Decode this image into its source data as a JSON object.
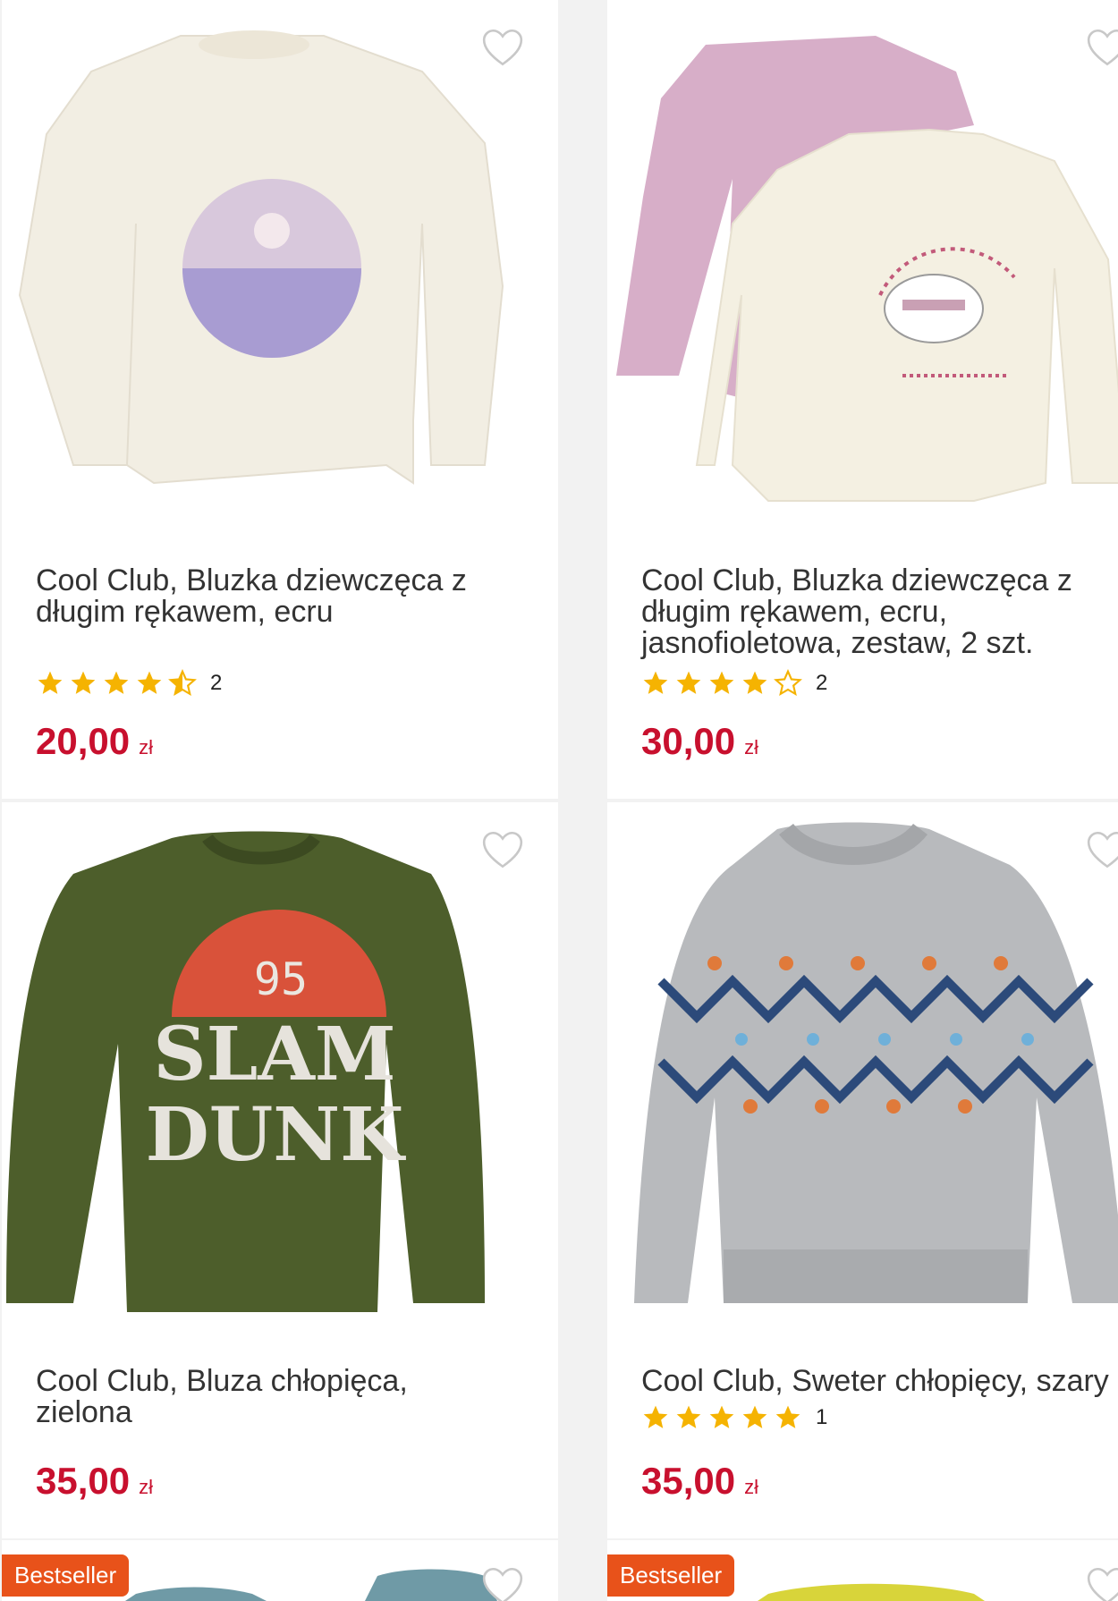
{
  "products": [
    {
      "title": "Cool Club, Bluzka dziewczęca z długim rękawem, ecru",
      "rating_count": "2",
      "rating": 4.5,
      "price": "20,00",
      "currency": "zł"
    },
    {
      "title": "Cool Club, Bluzka dziewczęca z długim rękawem, ecru, jasnofioletowa, zestaw, 2 szt.",
      "rating_count": "2",
      "rating": 4,
      "price": "30,00",
      "currency": "zł"
    },
    {
      "title": "Cool Club, Bluza chłopięca, zielona",
      "price": "35,00",
      "currency": "zł",
      "print_number": "95",
      "print_line1": "SLAM",
      "print_line2": "DUNK"
    },
    {
      "title": "Cool Club, Sweter chłopięcy, szary",
      "rating_count": "1",
      "rating": 5,
      "price": "35,00",
      "currency": "zł"
    },
    {
      "badge": "Bestseller"
    },
    {
      "badge": "Bestseller"
    }
  ],
  "colors": {
    "price": "#c8102e",
    "star": "#f5b301",
    "badge": "#e8521a"
  }
}
